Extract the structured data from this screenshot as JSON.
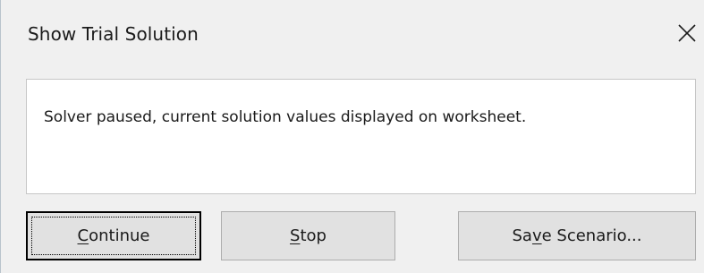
{
  "dialog": {
    "title": "Show Trial Solution",
    "close_icon": "close-icon",
    "message": "Solver paused, current solution values displayed on worksheet."
  },
  "buttons": {
    "continue": {
      "label_prefix": "",
      "mnemonic": "C",
      "label_suffix": "ontinue"
    },
    "stop": {
      "label_prefix": "",
      "mnemonic": "S",
      "label_suffix": "top"
    },
    "save_scenario": {
      "label_prefix": "Sa",
      "mnemonic": "v",
      "label_suffix": "e Scenario..."
    }
  }
}
